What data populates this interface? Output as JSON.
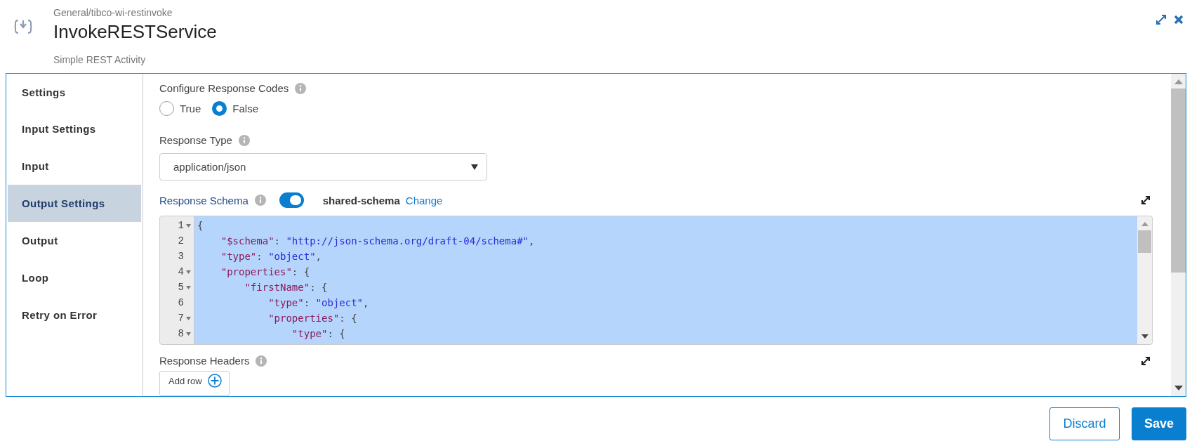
{
  "header": {
    "breadcrumb": "General/tibco-wi-restinvoke",
    "title": "InvokeRESTService",
    "subtitle": "Simple REST Activity"
  },
  "sidebar": {
    "items": [
      {
        "label": "Settings",
        "selected": false
      },
      {
        "label": "Input Settings",
        "selected": false
      },
      {
        "label": "Input",
        "selected": false
      },
      {
        "label": "Output Settings",
        "selected": true
      },
      {
        "label": "Output",
        "selected": false
      },
      {
        "label": "Loop",
        "selected": false
      },
      {
        "label": "Retry on Error",
        "selected": false
      }
    ]
  },
  "configure_response_codes": {
    "label": "Configure Response Codes",
    "options": [
      {
        "label": "True",
        "selected": false
      },
      {
        "label": "False",
        "selected": true
      }
    ]
  },
  "response_type": {
    "label": "Response Type",
    "value": "application/json"
  },
  "response_schema": {
    "label": "Response Schema",
    "toggle_on": true,
    "schema_name": "shared-schema",
    "change_link": "Change",
    "code_lines": [
      {
        "number": "1",
        "foldable": true,
        "tokens": [
          {
            "kind": "punct",
            "text": "{"
          }
        ]
      },
      {
        "number": "2",
        "foldable": false,
        "tokens": [
          {
            "kind": "key",
            "text": "    \"$schema\""
          },
          {
            "kind": "punct",
            "text": ": "
          },
          {
            "kind": "string",
            "text": "\"http://json-schema.org/draft-04/schema#\""
          },
          {
            "kind": "punct",
            "text": ","
          }
        ]
      },
      {
        "number": "3",
        "foldable": false,
        "tokens": [
          {
            "kind": "key",
            "text": "    \"type\""
          },
          {
            "kind": "punct",
            "text": ": "
          },
          {
            "kind": "string",
            "text": "\"object\""
          },
          {
            "kind": "punct",
            "text": ","
          }
        ]
      },
      {
        "number": "4",
        "foldable": true,
        "tokens": [
          {
            "kind": "key",
            "text": "    \"properties\""
          },
          {
            "kind": "punct",
            "text": ": {"
          }
        ]
      },
      {
        "number": "5",
        "foldable": true,
        "tokens": [
          {
            "kind": "key",
            "text": "        \"firstName\""
          },
          {
            "kind": "punct",
            "text": ": {"
          }
        ]
      },
      {
        "number": "6",
        "foldable": false,
        "tokens": [
          {
            "kind": "key",
            "text": "            \"type\""
          },
          {
            "kind": "punct",
            "text": ": "
          },
          {
            "kind": "string",
            "text": "\"object\""
          },
          {
            "kind": "punct",
            "text": ","
          }
        ]
      },
      {
        "number": "7",
        "foldable": true,
        "tokens": [
          {
            "kind": "key",
            "text": "            \"properties\""
          },
          {
            "kind": "punct",
            "text": ": {"
          }
        ]
      },
      {
        "number": "8",
        "foldable": true,
        "tokens": [
          {
            "kind": "key",
            "text": "                \"type\""
          },
          {
            "kind": "punct",
            "text": ": {"
          }
        ]
      }
    ]
  },
  "response_headers": {
    "label": "Response Headers",
    "add_row": "Add row"
  },
  "buttons": [
    {
      "label": "Discard",
      "kind": "secondary"
    },
    {
      "label": "Save",
      "kind": "primary"
    }
  ]
}
